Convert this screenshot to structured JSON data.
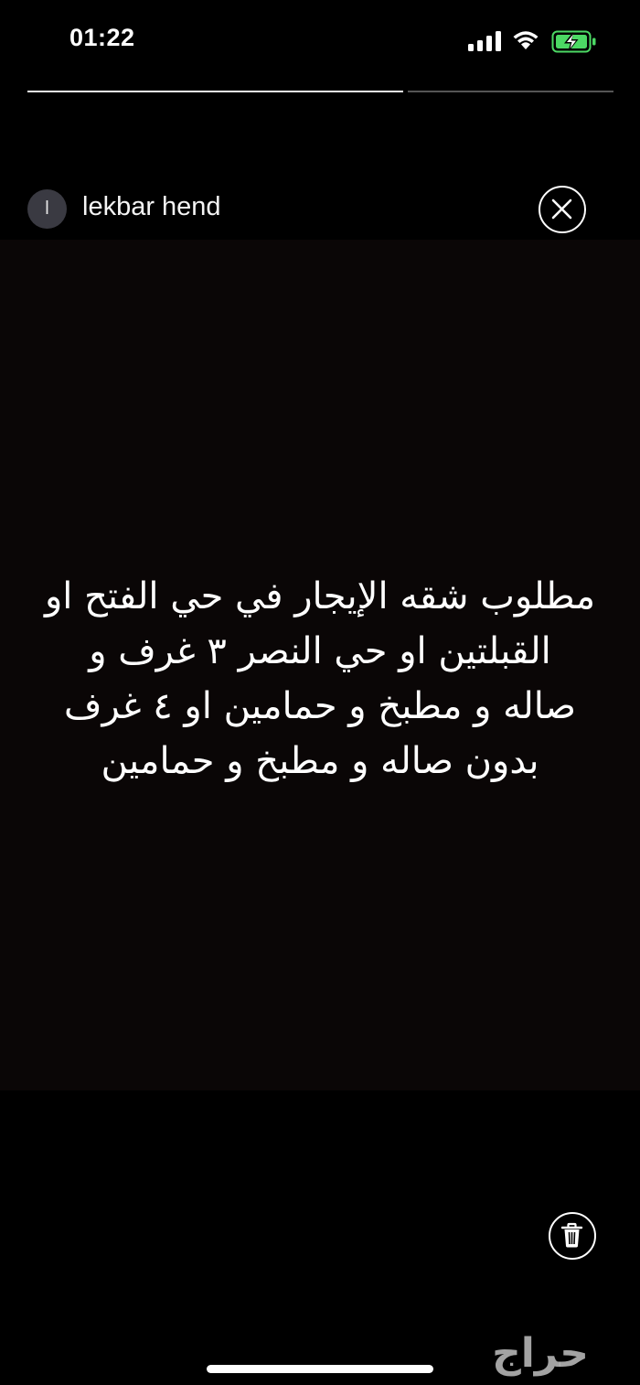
{
  "status_bar": {
    "time": "01:22",
    "signal_icon": "cellular-signal-icon",
    "wifi_icon": "wifi-icon",
    "battery_icon": "battery-charging-icon",
    "battery_color": "#4cd964"
  },
  "story": {
    "progress": [
      1.0,
      0.0
    ],
    "user": {
      "initial": "l",
      "name": "lekbar hend"
    },
    "close_icon": "close-icon",
    "text_lines": [
      "مطلوب شقه الإيجار في حي الفتح او",
      "القبلتين او حي النصر ٣ غرف و",
      "صاله و مطبخ و حمامين او ٤ غرف",
      "بدون صاله و مطبخ و حمامين"
    ],
    "delete_icon": "trash-icon"
  },
  "watermark": {
    "text": "حراج",
    "color": "#bfbfbf"
  }
}
